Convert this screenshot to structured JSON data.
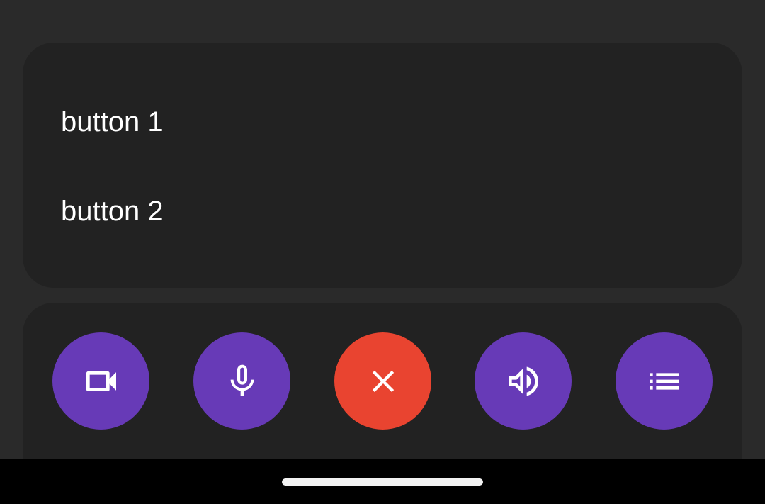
{
  "menu": {
    "items": [
      {
        "label": "button 1"
      },
      {
        "label": "button 2"
      }
    ]
  },
  "controls": {
    "buttons": [
      {
        "icon": "videocam-icon",
        "color": "#673ab7"
      },
      {
        "icon": "mic-icon",
        "color": "#673ab7"
      },
      {
        "icon": "close-icon",
        "color": "#e94430"
      },
      {
        "icon": "volume-icon",
        "color": "#673ab7"
      },
      {
        "icon": "list-icon",
        "color": "#673ab7"
      }
    ]
  },
  "theme": {
    "background": "#2a2a2a",
    "card": "#222222",
    "accent": "#673ab7",
    "danger": "#e94430",
    "text": "#ffffff"
  }
}
